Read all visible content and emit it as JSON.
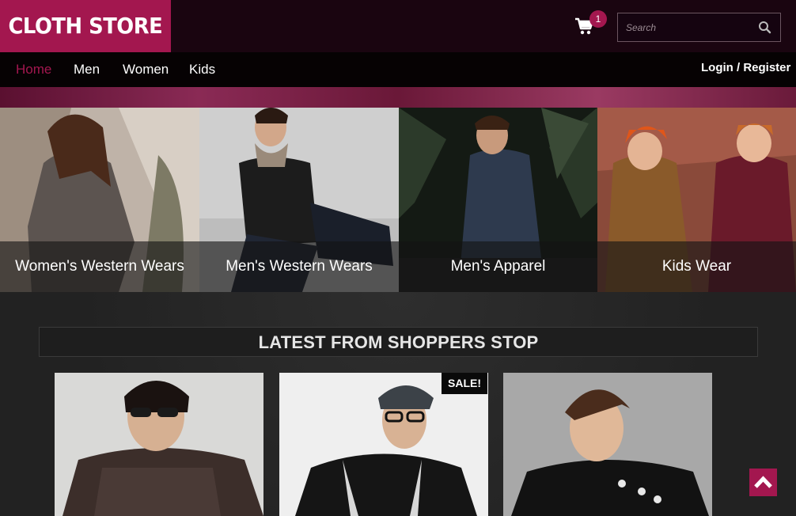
{
  "header": {
    "logo": "CLOTH STORE",
    "cart_count": "1",
    "cart_icon": "cart-icon",
    "search_placeholder": "Search",
    "search_icon": "search-icon"
  },
  "nav": {
    "items": [
      {
        "label": "Home",
        "active": true
      },
      {
        "label": "Men",
        "active": false
      },
      {
        "label": "Women",
        "active": false
      },
      {
        "label": "Kids",
        "active": false
      }
    ],
    "login": "Login / Register"
  },
  "categories": [
    {
      "label": "Women's Western Wears"
    },
    {
      "label": "Men's Western Wears"
    },
    {
      "label": "Men's Apparel"
    },
    {
      "label": "Kids Wear"
    }
  ],
  "latest": {
    "title": "LATEST FROM SHOPPERS STOP",
    "sale_label": "SALE!"
  },
  "colors": {
    "brand": "#a3174f",
    "header_bg": "#1a0510",
    "nav_bg": "#060203"
  },
  "scroll_top_icon": "chevron-up-icon"
}
